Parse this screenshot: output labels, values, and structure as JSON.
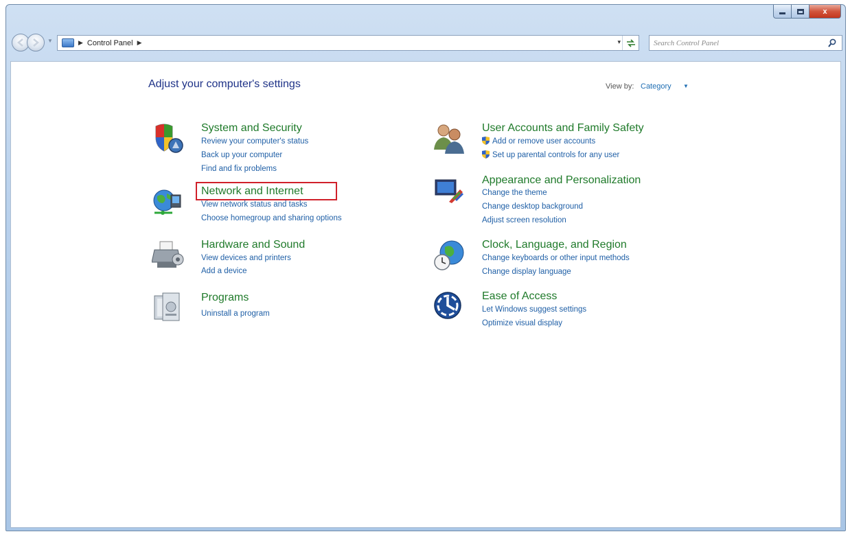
{
  "window": {
    "caption": {
      "close_glyph": "x"
    }
  },
  "navbar": {
    "breadcrumb": [
      "Control Panel"
    ],
    "address_dropdown_glyph": "▾",
    "search_placeholder": "Search Control Panel"
  },
  "main": {
    "title": "Adjust your computer's settings",
    "view_by_label": "View by:",
    "view_by_value": "Category",
    "categories": [
      {
        "title": "System and Security",
        "icon": "security-shield-icon",
        "links": [
          "Review your computer's status",
          "Back up your computer",
          "Find and fix problems"
        ]
      },
      {
        "title": "Network and Internet",
        "icon": "network-globe-icon",
        "highlighted": true,
        "links": [
          "View network status and tasks",
          "Choose homegroup and sharing options"
        ]
      },
      {
        "title": "Hardware and Sound",
        "icon": "printer-icon",
        "links": [
          "View devices and printers",
          "Add a device"
        ]
      },
      {
        "title": "Programs",
        "icon": "programs-icon",
        "links": [
          "Uninstall a program"
        ]
      },
      {
        "title": "User Accounts and Family Safety",
        "icon": "users-icon",
        "links": [
          "Add or remove user accounts",
          "Set up parental controls for any user"
        ]
      },
      {
        "title": "Appearance and Personalization",
        "icon": "monitor-brush-icon",
        "links": [
          "Change the theme",
          "Change desktop background",
          "Adjust screen resolution"
        ]
      },
      {
        "title": "Clock, Language, and Region",
        "icon": "clock-globe-icon",
        "links": [
          "Change keyboards or other input methods",
          "Change display language"
        ]
      },
      {
        "title": "Ease of Access",
        "icon": "ease-of-access-icon",
        "links": [
          "Let Windows suggest settings",
          "Optimize visual display"
        ]
      }
    ]
  },
  "colors": {
    "category_title": "#1f7a2a",
    "link": "#1f5fa6",
    "page_title": "#1e3287",
    "highlight": "#d0202a"
  }
}
